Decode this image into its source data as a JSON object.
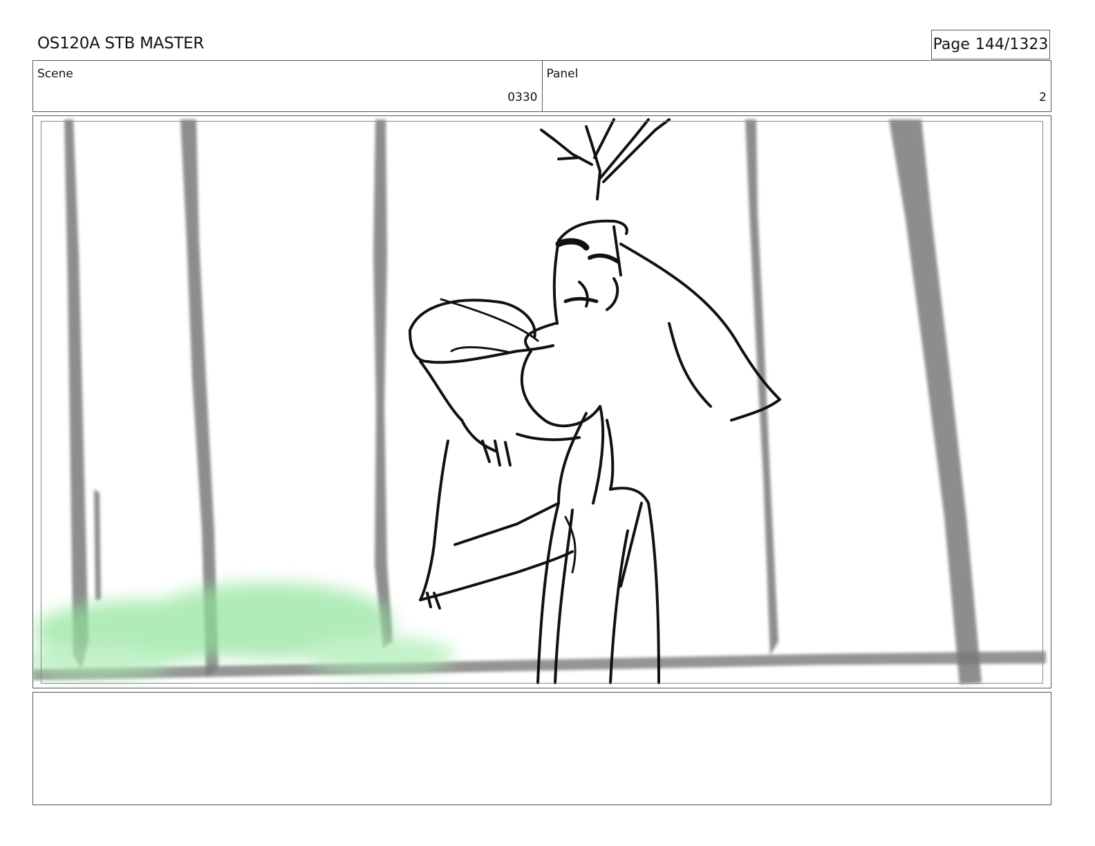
{
  "header": {
    "title": "OS120A STB MASTER",
    "page_label": "Page",
    "page_number": "144/1323"
  },
  "info": {
    "scene_label": "Scene",
    "scene_value": "0330",
    "panel_label": "Panel",
    "panel_value": "2"
  },
  "frame": {
    "image_description_icon": "storyboard-sketch",
    "palette": {
      "line": "#111111",
      "tree": "#7a7a7a",
      "foliage": "#8fe39a"
    }
  },
  "notes": {
    "text": ""
  }
}
